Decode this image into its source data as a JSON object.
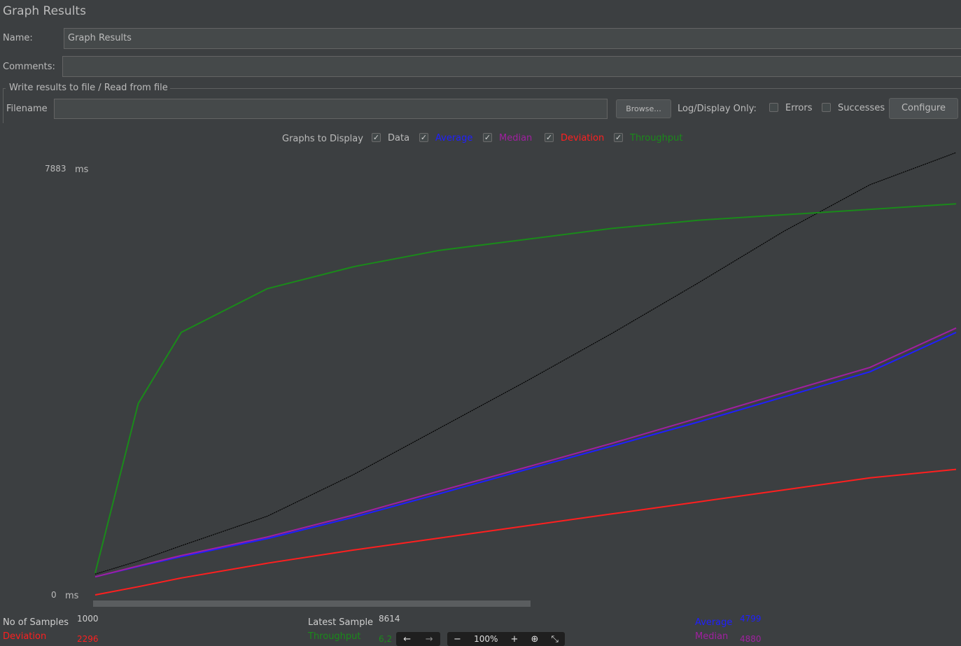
{
  "title": "Graph Results",
  "form": {
    "name_label": "Name:",
    "name_value": "Graph Results",
    "comments_label": "Comments:",
    "comments_value": "",
    "fieldset_legend": "Write results to file / Read from file",
    "filename_label": "Filename",
    "filename_value": "",
    "browse_label": "Browse...",
    "log_display_label": "Log/Display Only:",
    "errors_label": "Errors",
    "successes_label": "Successes",
    "configure_label": "Configure"
  },
  "graphs": {
    "label": "Graphs to Display",
    "items": [
      {
        "label": "Data",
        "checked": true,
        "color": "#bbbbbb"
      },
      {
        "label": "Average",
        "checked": true,
        "color": "#1f1fff"
      },
      {
        "label": "Median",
        "checked": true,
        "color": "#a020a0"
      },
      {
        "label": "Deviation",
        "checked": true,
        "color": "#ff1f1f"
      },
      {
        "label": "Throughput",
        "checked": true,
        "color": "#1a8a1a"
      }
    ]
  },
  "chart_data": {
    "type": "line",
    "y_max_label": "7883",
    "y_min_label": "0",
    "y_unit": "ms",
    "ylim": [
      0,
      7883
    ],
    "x": [
      0,
      50,
      100,
      200,
      300,
      400,
      500,
      600,
      700,
      800,
      900,
      1000
    ],
    "series": [
      {
        "key": "data",
        "color": "#000000",
        "values": [
          380,
          620,
          900,
          1440,
          2200,
          3050,
          3900,
          4780,
          5700,
          6650,
          7500,
          8100
        ]
      },
      {
        "key": "average",
        "color": "#1f1fff",
        "values": [
          330,
          520,
          700,
          1030,
          1420,
          1850,
          2290,
          2720,
          3160,
          3620,
          4080,
          4799
        ]
      },
      {
        "key": "median",
        "color": "#a020a0",
        "values": [
          330,
          530,
          720,
          1060,
          1460,
          1900,
          2330,
          2770,
          3230,
          3700,
          4160,
          4880
        ]
      },
      {
        "key": "deviation",
        "color": "#ff1f1f",
        "values": [
          0,
          150,
          310,
          580,
          820,
          1040,
          1260,
          1480,
          1700,
          1920,
          2140,
          2296
        ]
      },
      {
        "key": "throughput",
        "color": "#1a8a1a",
        "values": [
          400,
          3500,
          4800,
          5600,
          6000,
          6300,
          6500,
          6700,
          6850,
          6950,
          7050,
          7150
        ]
      }
    ]
  },
  "summary": {
    "samples_label": "No of Samples",
    "samples_value": "1000",
    "deviation_label": "Deviation",
    "deviation_value": "2296",
    "latest_label": "Latest Sample",
    "latest_value": "8614",
    "throughput_label": "Throughput",
    "throughput_value": "6,2",
    "average_label": "Average",
    "average_value": "4799",
    "median_label": "Median",
    "median_value": "4880"
  },
  "zoom": {
    "back_icon": "←",
    "forward_icon": "→",
    "minus_icon": "−",
    "level": "100%",
    "plus_icon": "+",
    "download_icon": "⊕",
    "collapse_icon": "⤡"
  },
  "colors": {
    "background": "#3c3f41",
    "data": "#000000",
    "average": "#1f1fff",
    "median": "#a020a0",
    "deviation": "#ff1f1f",
    "throughput": "#1a8a1a"
  }
}
